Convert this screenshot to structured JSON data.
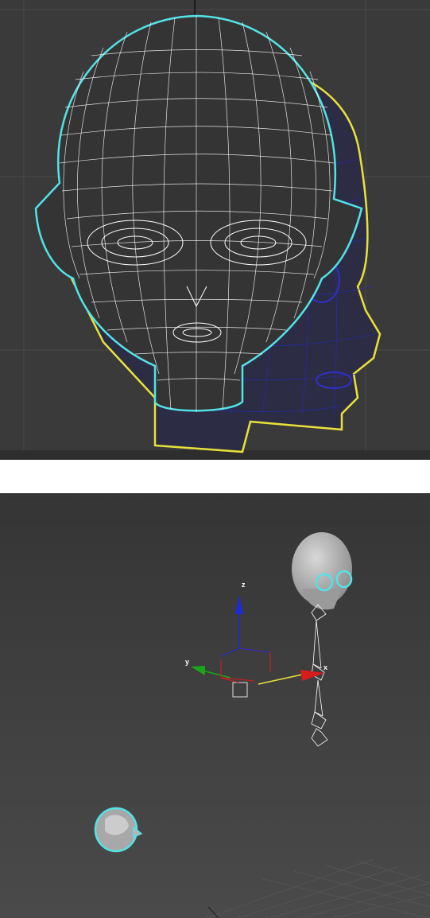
{
  "viewports": {
    "front": {
      "kind": "wireframe-front"
    },
    "perspective": {
      "kind": "shaded-perspective"
    }
  },
  "gizmo": {
    "x_label": "x",
    "y_label": "y",
    "z_label": "z"
  },
  "colors": {
    "viewport_bg": "#3a3a3a",
    "selection_outline": "#52e3e8",
    "secondary_outline": "#e8e23a",
    "wire_white": "#ffffff",
    "wire_blue": "#2a2ab0",
    "axis_x": "#d81c1c",
    "axis_y": "#1aa51a",
    "axis_z": "#1c2ad8"
  }
}
